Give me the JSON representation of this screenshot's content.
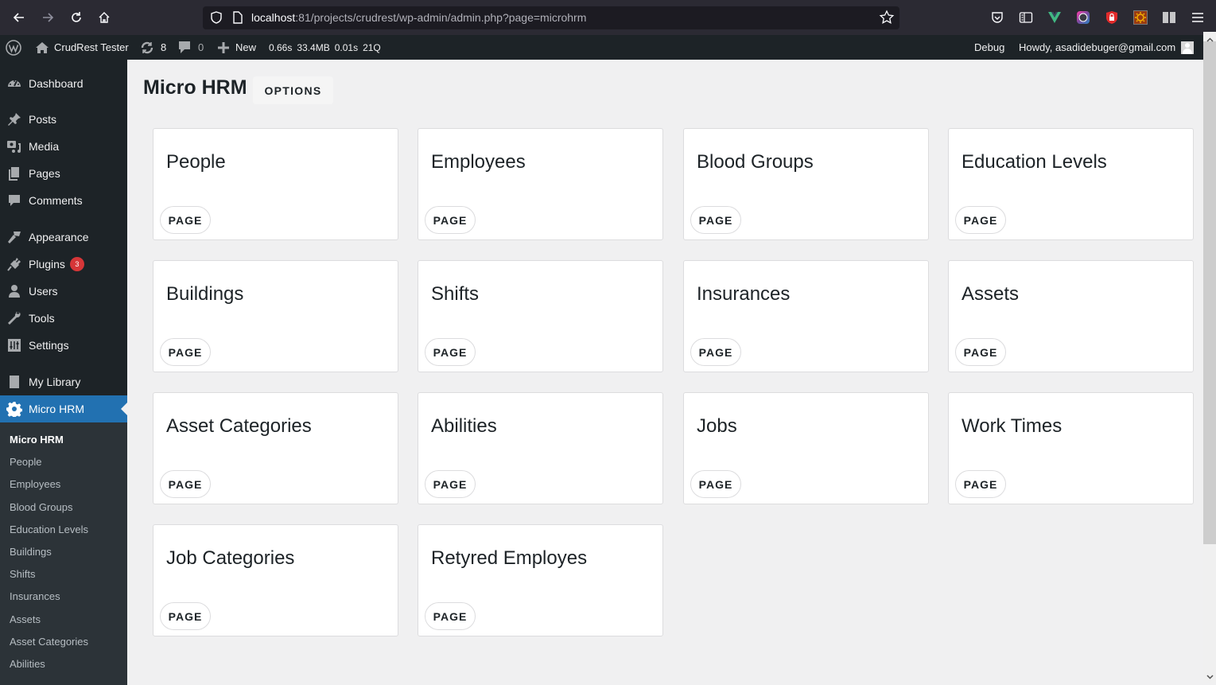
{
  "browser": {
    "url_host": "localhost",
    "url_rest": ":81/projects/crudrest/wp-admin/admin.php?page=microhrm",
    "extensions": [
      "pocket-icon",
      "reader-view-icon",
      "vue-devtools-icon",
      "color-picker-icon",
      "lock-shield-icon",
      "sun-extension-icon",
      "library-icon",
      "menu-icon"
    ]
  },
  "admin_bar": {
    "site_name": "CrudRest Tester",
    "updates_count": "8",
    "comments_count": "0",
    "new_label": "New",
    "stats": {
      "time1": "0.66s",
      "memory": "33.4MB",
      "time2": "0.01s",
      "queries": "21Q"
    },
    "debug_label": "Debug",
    "howdy": "Howdy, asadidebuger@gmail.com"
  },
  "sidebar": {
    "items": [
      {
        "label": "Dashboard",
        "icon": "dashboard-icon"
      },
      {
        "label": "Posts",
        "icon": "pin-icon"
      },
      {
        "label": "Media",
        "icon": "media-icon"
      },
      {
        "label": "Pages",
        "icon": "pages-icon"
      },
      {
        "label": "Comments",
        "icon": "comment-icon"
      },
      {
        "label": "Appearance",
        "icon": "brush-icon"
      },
      {
        "label": "Plugins",
        "icon": "plug-icon",
        "badge": "3"
      },
      {
        "label": "Users",
        "icon": "user-icon"
      },
      {
        "label": "Tools",
        "icon": "wrench-icon"
      },
      {
        "label": "Settings",
        "icon": "settings-icon"
      },
      {
        "label": "My Library",
        "icon": "book-icon"
      },
      {
        "label": "Micro HRM",
        "icon": "gear-icon",
        "active": true
      }
    ],
    "submenu": [
      {
        "label": "Micro HRM",
        "current": true
      },
      {
        "label": "People"
      },
      {
        "label": "Employees"
      },
      {
        "label": "Blood Groups"
      },
      {
        "label": "Education Levels"
      },
      {
        "label": "Buildings"
      },
      {
        "label": "Shifts"
      },
      {
        "label": "Insurances"
      },
      {
        "label": "Assets"
      },
      {
        "label": "Asset Categories"
      },
      {
        "label": "Abilities"
      }
    ]
  },
  "main": {
    "title": "Micro HRM",
    "options_label": "OPTIONS",
    "page_button_label": "PAGE",
    "cards": [
      {
        "title": "People"
      },
      {
        "title": "Employees"
      },
      {
        "title": "Blood Groups"
      },
      {
        "title": "Education Levels"
      },
      {
        "title": "Buildings"
      },
      {
        "title": "Shifts"
      },
      {
        "title": "Insurances"
      },
      {
        "title": "Assets"
      },
      {
        "title": "Asset Categories"
      },
      {
        "title": "Abilities"
      },
      {
        "title": "Jobs"
      },
      {
        "title": "Work Times"
      },
      {
        "title": "Job Categories"
      },
      {
        "title": "Retyred Employes"
      }
    ]
  },
  "colors": {
    "admin_dark": "#1d2327",
    "accent_blue": "#2271b1",
    "badge_red": "#d63638",
    "content_bg": "#f0f0f1"
  }
}
